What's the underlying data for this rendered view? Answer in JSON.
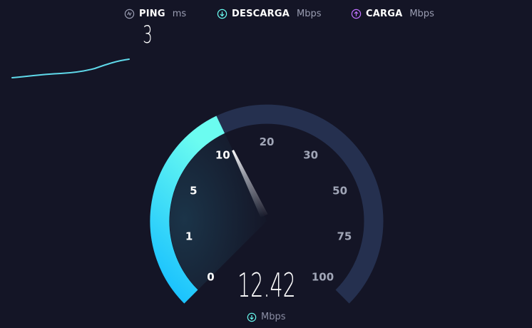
{
  "metrics": {
    "ping": {
      "label": "PING",
      "unit": "ms",
      "value": "3",
      "icon": "ping-icon",
      "color": "#9a9db2"
    },
    "download": {
      "label": "DESCARGA",
      "unit": "Mbps",
      "icon": "download-icon",
      "color": "#6afff3"
    },
    "upload": {
      "label": "CARGA",
      "unit": "Mbps",
      "icon": "upload-icon",
      "color": "#bf71ff"
    }
  },
  "gauge": {
    "ticks": [
      "0",
      "1",
      "5",
      "10",
      "20",
      "30",
      "50",
      "75",
      "100"
    ],
    "current_speed": "12.42",
    "unit": "Mbps",
    "colors": {
      "track": "#25304f",
      "fill_start": "#13bdff",
      "fill_end": "#6bfcf0",
      "active_tick": "#ffffff",
      "inactive_tick": "#a1a6b7"
    }
  }
}
